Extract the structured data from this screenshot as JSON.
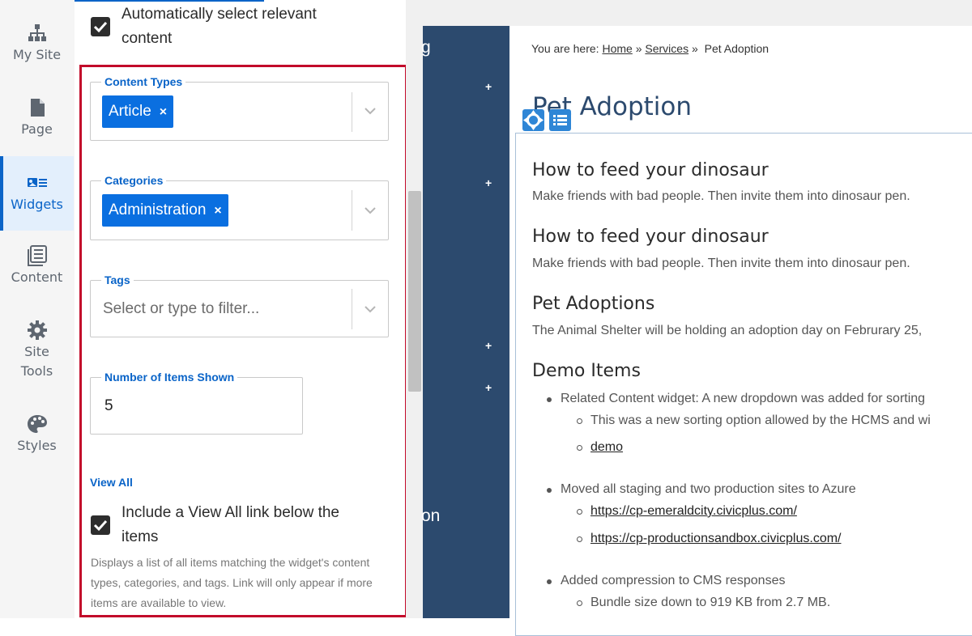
{
  "left_nav": {
    "items": [
      {
        "label": "My Site",
        "icon": "sitemap-icon"
      },
      {
        "label": "Page",
        "icon": "page-icon"
      },
      {
        "label": "Widgets",
        "icon": "widgets-icon",
        "active": true
      },
      {
        "label": "Content",
        "icon": "content-icon"
      },
      {
        "label": "Site",
        "label2": "Tools",
        "icon": "gear-icon"
      },
      {
        "label": "Styles",
        "icon": "palette-icon"
      }
    ]
  },
  "panel": {
    "auto_select": {
      "label_line1": "Automatically select relevant",
      "label_line2": "content",
      "checked": true
    },
    "content_types": {
      "legend": "Content Types",
      "chips": [
        "Article"
      ]
    },
    "categories": {
      "legend": "Categories",
      "chips": [
        "Administration"
      ]
    },
    "tags": {
      "legend": "Tags",
      "placeholder": "Select or type to filter..."
    },
    "items_shown": {
      "legend": "Number of Items Shown",
      "value": "5"
    },
    "view_all": {
      "heading": "View All",
      "label_line1": "Include a View All link below the",
      "label_line2": "items",
      "checked": true,
      "help": "Displays a list of all items matching the widget's content types, categories, and tags. Link will only appear if more items are available to view."
    },
    "remove_symbol": "×"
  },
  "site": {
    "nav_fragments": [
      "g",
      "on"
    ],
    "nav_plus": "+",
    "breadcrumb": {
      "prefix": "You are here:",
      "home": "Home",
      "services": " Services",
      "current": "Pet Adoption",
      "sep": "»"
    },
    "page_title": "Pet Adoption",
    "items": [
      {
        "title": "How to feed your dinosaur",
        "desc": "Make friends with bad people. Then invite them into dinosaur pen."
      },
      {
        "title": "How to feed your dinosaur",
        "desc": "Make friends with bad people. Then invite them into dinosaur pen."
      },
      {
        "title": "Pet Adoptions",
        "desc": "The Animal Shelter will be holding an adoption day on Februrary 25,"
      }
    ],
    "demo": {
      "title": "Demo Items",
      "b1": "Related Content widget: A new dropdown was added for sorting",
      "b1_sub1": "This was a new sorting option allowed by the HCMS and wi",
      "b1_sub2": "demo",
      "b2": "Moved all staging and two production sites to Azure",
      "b2_sub1": "https://cp-emeraldcity.civicplus.com/",
      "b2_sub2": "https://cp-productionsandbox.civicplus.com/",
      "b3": "Added compression to CMS responses",
      "b3_sub1": "Bundle size down to 919 KB from 2.7 MB."
    }
  }
}
